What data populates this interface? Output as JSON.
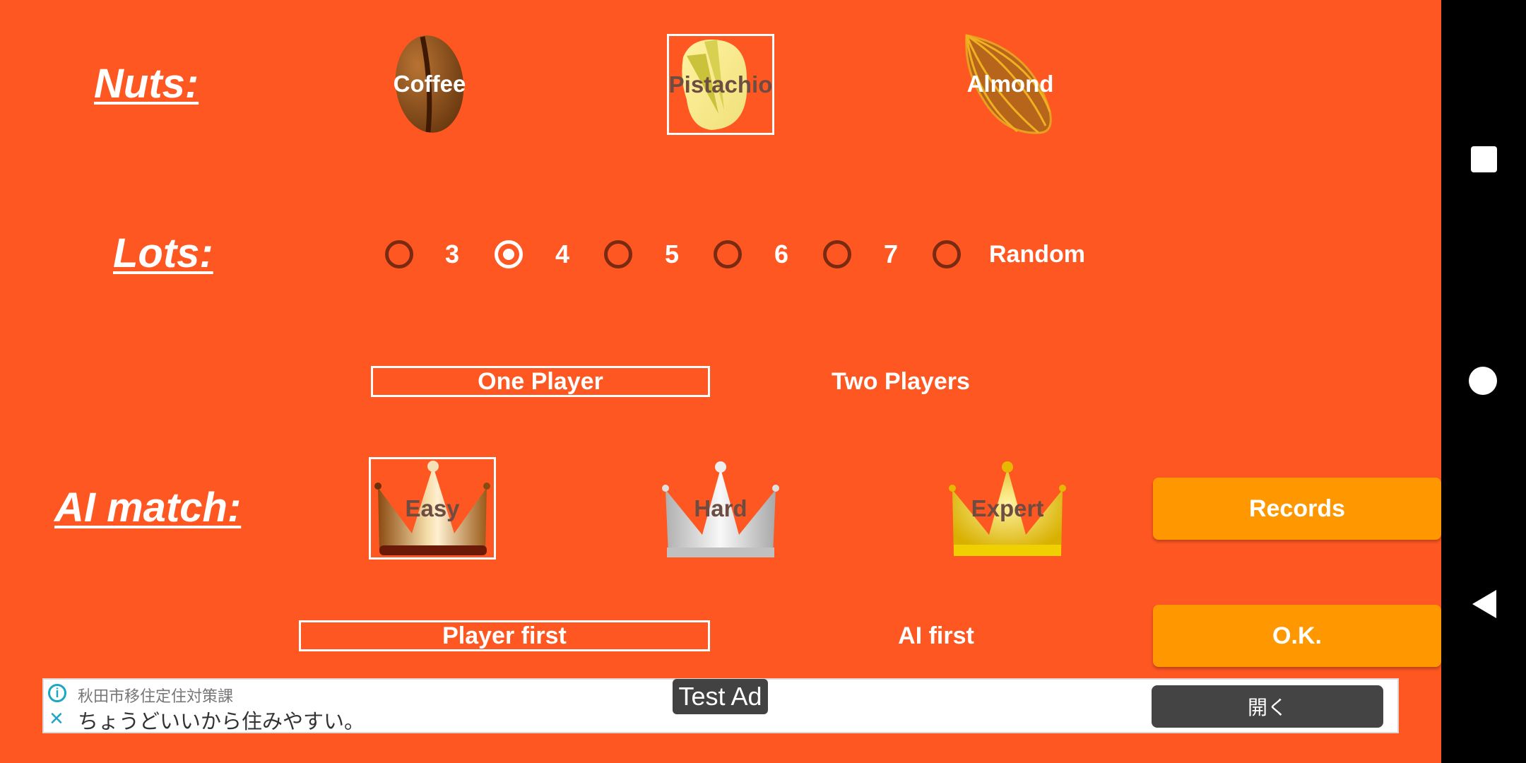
{
  "colors": {
    "background": "#FF5722",
    "button": "#FF9800",
    "radio_unchecked": "#7a2a10",
    "crown_label": "#6d4c41",
    "ad_accent": "#1ba6c4"
  },
  "nuts": {
    "label": "Nuts:",
    "options": [
      {
        "label": "Coffee",
        "icon": "coffee-bean-icon",
        "selected": false
      },
      {
        "label": "Pistachio",
        "icon": "pistachio-icon",
        "selected": true
      },
      {
        "label": "Almond",
        "icon": "almond-icon",
        "selected": false
      }
    ]
  },
  "lots": {
    "label": "Lots:",
    "options": [
      "3",
      "4",
      "5",
      "6",
      "7",
      "Random"
    ],
    "selected": "4"
  },
  "players": {
    "options": [
      {
        "label": "One Player",
        "selected": true
      },
      {
        "label": "Two Players",
        "selected": false
      }
    ]
  },
  "ai_match": {
    "label": "AI match:",
    "levels": [
      {
        "label": "Easy",
        "icon": "bronze-crown-icon",
        "selected": true
      },
      {
        "label": "Hard",
        "icon": "silver-crown-icon",
        "selected": false
      },
      {
        "label": "Expert",
        "icon": "gold-crown-icon",
        "selected": false
      }
    ]
  },
  "turn_order": {
    "options": [
      {
        "label": "Player first",
        "selected": true
      },
      {
        "label": "AI first",
        "selected": false
      }
    ]
  },
  "buttons": {
    "records": "Records",
    "ok": "O.K."
  },
  "ad": {
    "badge": "Test Ad",
    "advertiser": "秋田市移住定住対策課",
    "headline": "ちょうどいいから住みやすい。",
    "cta": "開く"
  },
  "navbar": {
    "recents": "recents-icon",
    "home": "home-icon",
    "back": "back-icon"
  }
}
